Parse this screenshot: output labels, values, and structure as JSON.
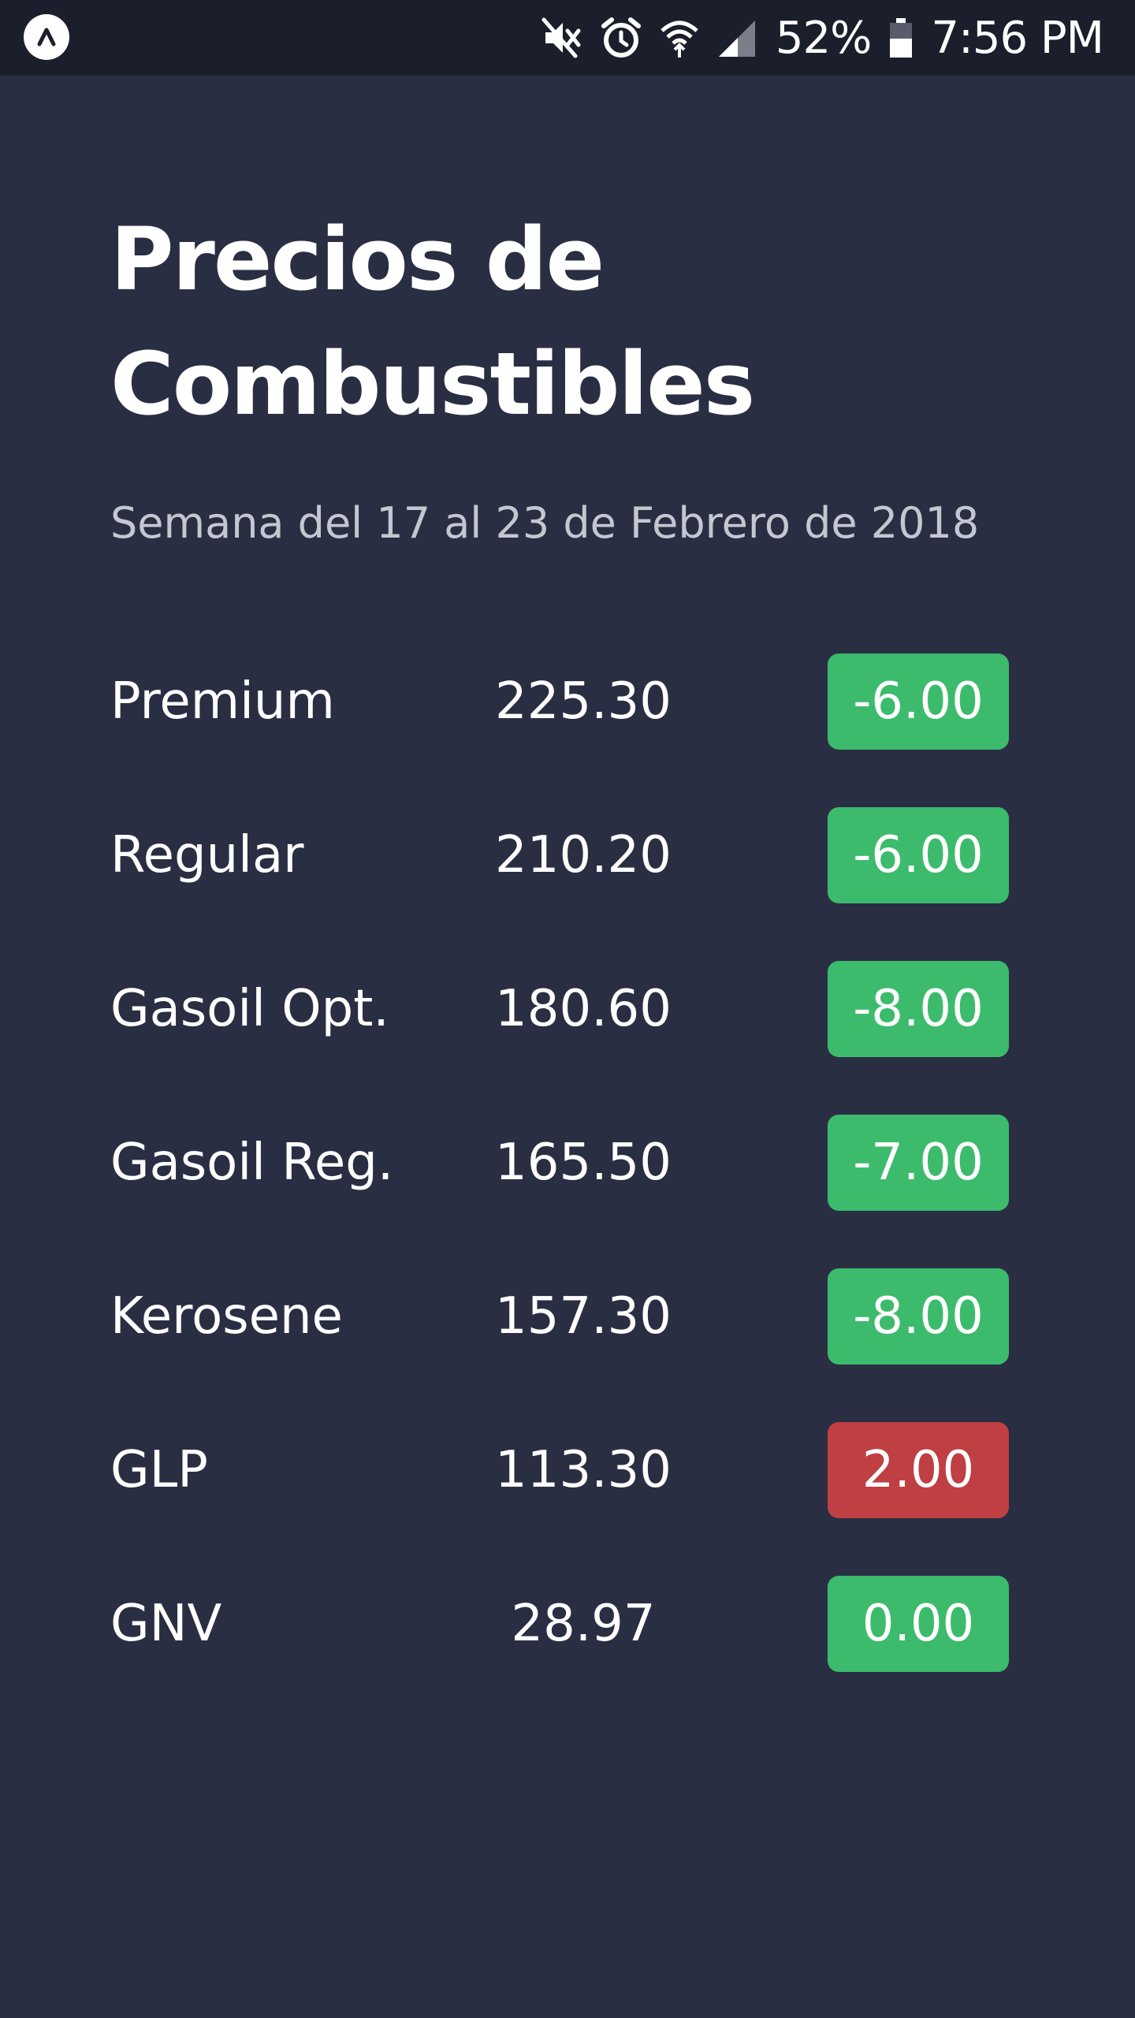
{
  "status_bar": {
    "battery": "52%",
    "time": "7:56 PM",
    "icons": [
      "app-logo-icon",
      "mute-icon",
      "alarm-icon",
      "wifi-icon",
      "signal-icon",
      "battery-icon"
    ]
  },
  "header": {
    "title": "Precios de Combustibles",
    "subtitle": "Semana del 17 al 23 de Febrero de 2018"
  },
  "colors": {
    "background": "#292e43",
    "status_bar": "#1b1e2b",
    "decrease": "#3dbb6c",
    "increase": "#bf3f42"
  },
  "fuels": [
    {
      "name": "Premium",
      "price": "225.30",
      "change": "-6.00",
      "trend": "down"
    },
    {
      "name": "Regular",
      "price": "210.20",
      "change": "-6.00",
      "trend": "down"
    },
    {
      "name": "Gasoil Opt.",
      "price": "180.60",
      "change": "-8.00",
      "trend": "down"
    },
    {
      "name": "Gasoil Reg.",
      "price": "165.50",
      "change": "-7.00",
      "trend": "down"
    },
    {
      "name": "Kerosene",
      "price": "157.30",
      "change": "-8.00",
      "trend": "down"
    },
    {
      "name": "GLP",
      "price": "113.30",
      "change": "2.00",
      "trend": "up"
    },
    {
      "name": "GNV",
      "price": "28.97",
      "change": "0.00",
      "trend": "none"
    }
  ]
}
